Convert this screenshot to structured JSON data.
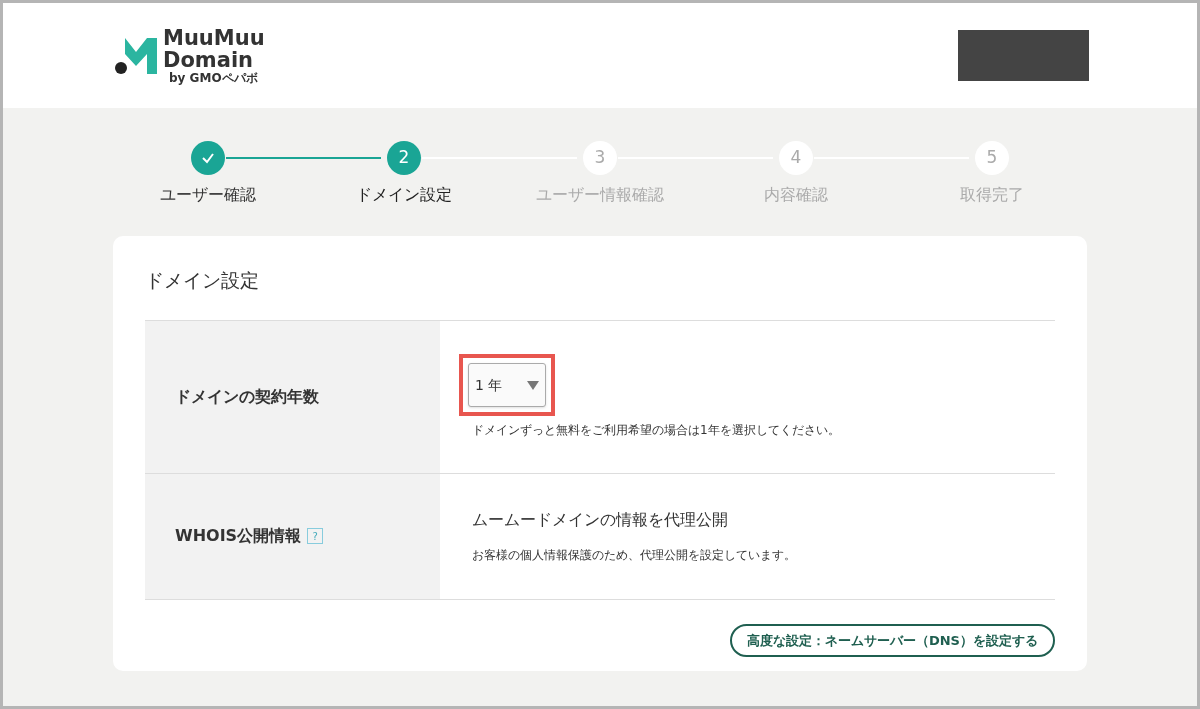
{
  "logo": {
    "line_1": "MuuMuu",
    "line_2": "Domain",
    "byline": "by GMOペパボ"
  },
  "steps": [
    {
      "label": "ユーザー確認",
      "completed": true,
      "selected": false
    },
    {
      "number": "2",
      "label": "ドメイン設定",
      "completed": false,
      "selected": true
    },
    {
      "number": "3",
      "label": "ユーザー情報確認",
      "completed": false,
      "selected": false
    },
    {
      "number": "4",
      "label": "内容確認",
      "completed": false,
      "selected": false
    },
    {
      "number": "5",
      "label": "取得完了",
      "completed": false,
      "selected": false
    }
  ],
  "card": {
    "title": "ドメイン設定",
    "rows": [
      {
        "kind": "select",
        "label": "ドメインの契約年数",
        "value": "1 年",
        "highlighted": true,
        "note": "ドメインずっと無料をご利用希望の場合は1年を選択してください。"
      },
      {
        "kind": "info",
        "label": "WHOIS公開情報",
        "help": "?",
        "heading": "ムームードメインの情報を代理公開",
        "note": "お客様の個人情報保護のため、代理公開を設定しています。"
      }
    ],
    "advanced_button": "高度な設定：ネームサーバー（DNS）を設定する"
  }
}
